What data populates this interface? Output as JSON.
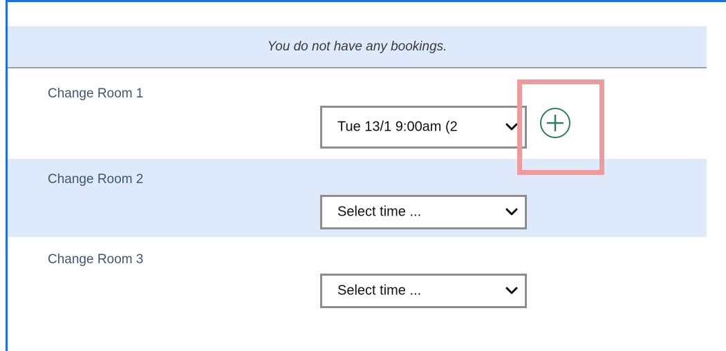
{
  "notice": {
    "message": "You do not have any bookings."
  },
  "rooms": [
    {
      "label": "Change Room 1",
      "selected_time": "Tue 13/1 9:00am (2",
      "add_icon": "plus-circle-icon"
    },
    {
      "label": "Change Room 2",
      "selected_time": "Select time ..."
    },
    {
      "label": "Change Room 3",
      "selected_time": "Select time ..."
    }
  ],
  "colors": {
    "accent_blue": "#1e6ee8",
    "row_shade": "#deeafb",
    "add_green": "#2e7d5b",
    "highlight_red": "#ef9a9d"
  }
}
